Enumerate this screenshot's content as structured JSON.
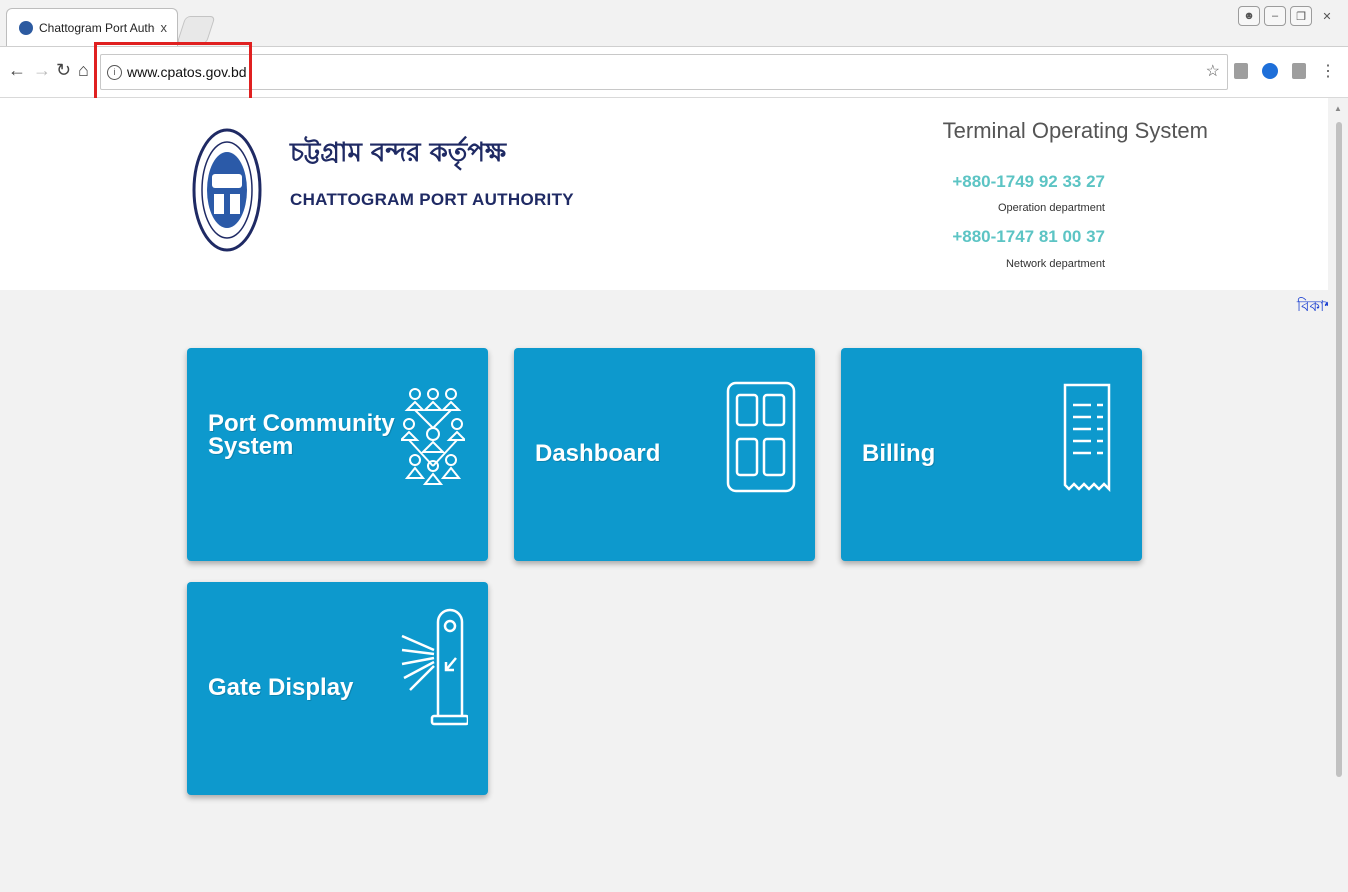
{
  "browser": {
    "tab_title": "Chattogram Port Authority",
    "tab_close": "x",
    "url": "www.cpatos.gov.bd",
    "colors": {
      "highlight": "#e02020",
      "tile": "#0d99cd",
      "brand": "#1f2a64",
      "phone": "#5cc4c4"
    }
  },
  "header": {
    "name_bangla": "চট্টগ্রাম বন্দর কর্তৃপক্ষ",
    "name_english": "CHATTOGRAM PORT AUTHORITY",
    "system_title": "Terminal Operating System",
    "contacts": [
      {
        "phone": "+880-1749 92 33 27",
        "department": "Operation department"
      },
      {
        "phone": "+880-1747 81 00 37",
        "department": "Network department"
      }
    ]
  },
  "marquee_text": "বিকাশ, ",
  "tiles": [
    {
      "label_line1": "Port Community",
      "label_line2": "System",
      "icon": "people-network-icon"
    },
    {
      "label": "Dashboard",
      "icon": "dashboard-icon"
    },
    {
      "label": "Billing",
      "icon": "receipt-icon"
    },
    {
      "label": "Gate Display",
      "icon": "gate-barrier-icon"
    }
  ]
}
